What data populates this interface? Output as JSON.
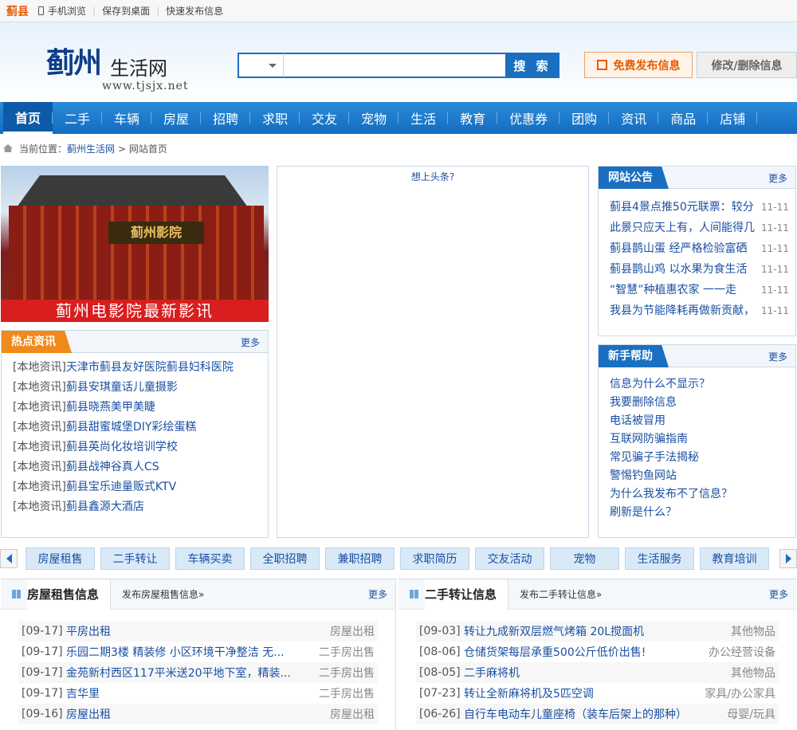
{
  "topbar": {
    "city": "蓟县",
    "mobile": "手机浏览",
    "save": "保存到桌面",
    "quick": "快速发布信息"
  },
  "logo": {
    "main": "蓟州",
    "sub": "生活网",
    "url": "www.tjsjx.net"
  },
  "search": {
    "button": "搜 索",
    "value": ""
  },
  "header": {
    "publish": "免费发布信息",
    "edit": "修改/删除信息"
  },
  "nav": [
    "首页",
    "二手",
    "车辆",
    "房屋",
    "招聘",
    "求职",
    "交友",
    "宠物",
    "生活",
    "教育",
    "优惠券",
    "团购",
    "资讯",
    "商品",
    "店铺"
  ],
  "breadcrumb": {
    "label": "当前位置：",
    "site": "蓟州生活网",
    "current": "> 网站首页"
  },
  "promo": {
    "sign": "蓟州影院",
    "caption": "蓟州电影院最新影讯"
  },
  "hot": {
    "title": "热点资讯",
    "more": "更多",
    "items": [
      {
        "pre": "[本地资讯]",
        "text": "天津市蓟县友好医院蓟县妇科医院"
      },
      {
        "pre": "[本地资讯]",
        "text": "蓟县安琪童话儿童摄影"
      },
      {
        "pre": "[本地资讯]",
        "text": "蓟县晓燕美甲美睫"
      },
      {
        "pre": "[本地资讯]",
        "text": "蓟县甜蜜城堡DIY彩绘蛋糕"
      },
      {
        "pre": "[本地资讯]",
        "text": "蓟县英尚化妆培训学校"
      },
      {
        "pre": "[本地资讯]",
        "text": "蓟县战神谷真人CS"
      },
      {
        "pre": "[本地资讯]",
        "text": "蓟县宝乐迪量贩式KTV"
      },
      {
        "pre": "[本地资讯]",
        "text": "蓟县鑫源大酒店"
      }
    ]
  },
  "center": {
    "ad": "想上头条?"
  },
  "notice": {
    "title": "网站公告",
    "more": "更多",
    "items": [
      {
        "text": "蓟县4景点推50元联票：较分",
        "date": "11-11"
      },
      {
        "text": "此景只应天上有，人间能得几",
        "date": "11-11"
      },
      {
        "text": "蓟县鹊山蛋 经严格检验富硒",
        "date": "11-11"
      },
      {
        "text": "蓟县鹊山鸡 以水果为食生活",
        "date": "11-11"
      },
      {
        "text": "“智慧”种植惠农家 一一走",
        "date": "11-11"
      },
      {
        "text": "我县为节能降耗再做新贡献，",
        "date": "11-11"
      }
    ]
  },
  "help": {
    "title": "新手帮助",
    "more": "更多",
    "items": [
      "信息为什么不显示？",
      "我要删除信息",
      "电话被冒用",
      "互联网防骗指南",
      "常见骗子手法揭秘",
      "警惕钓鱼网站",
      "为什么我发布不了信息？",
      "刷新是什么？"
    ]
  },
  "cats": [
    "房屋租售",
    "二手转让",
    "车辆买卖",
    "全职招聘",
    "兼职招聘",
    "求职简历",
    "交友活动",
    "宠物",
    "生活服务",
    "教育培训"
  ],
  "house_list": {
    "title": "房屋租售信息",
    "pub": "发布房屋租售信息»",
    "more": "更多",
    "rows": [
      {
        "date": "[09-17]",
        "text": "平房出租",
        "cat": "房屋出租"
      },
      {
        "date": "[09-17]",
        "text": "乐园二期3楼 精装修 小区环境干净整洁 无...",
        "cat": "二手房出售"
      },
      {
        "date": "[09-17]",
        "text": "金苑新村西区117平米送20平地下室，精装...",
        "cat": "二手房出售"
      },
      {
        "date": "[09-17]",
        "text": "吉华里",
        "cat": "二手房出售"
      },
      {
        "date": "[09-16]",
        "text": "房屋出租",
        "cat": "房屋出租"
      }
    ]
  },
  "second_list": {
    "title": "二手转让信息",
    "pub": "发布二手转让信息»",
    "more": "更多",
    "rows": [
      {
        "date": "[09-03]",
        "text": "转让九成新双层燃气烤箱 20L搅面机",
        "cat": "其他物品"
      },
      {
        "date": "[08-06]",
        "text": "仓储货架每层承重500公斤低价出售!",
        "cat": "办公经营设备"
      },
      {
        "date": "[08-05]",
        "text": "二手麻将机",
        "cat": "其他物品"
      },
      {
        "date": "[07-23]",
        "text": "转让全新麻将机及5匹空调",
        "cat": "家具/办公家具"
      },
      {
        "date": "[06-26]",
        "text": "自行车电动车儿童座椅（装车后架上的那种）",
        "cat": "母婴/玩具"
      }
    ]
  }
}
